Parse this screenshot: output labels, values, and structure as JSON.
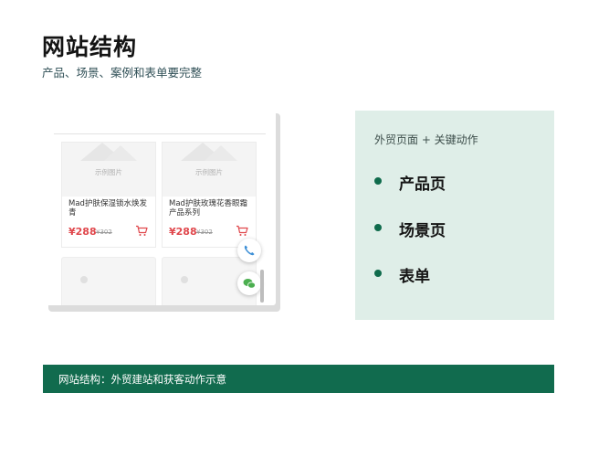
{
  "header": {
    "title": "网站结构",
    "subtitle": "产品、场景、案例和表单要完整"
  },
  "mockup": {
    "products": [
      {
        "image_label": "示例图片",
        "name": "Mad护肤保湿锁水焕发青",
        "price": "¥288",
        "old_price": "¥302"
      },
      {
        "image_label": "示例图片",
        "name": "Mad护肤玫瑰花香眼霜产品系列",
        "price": "¥288",
        "old_price": "¥302"
      }
    ],
    "floating_buttons": [
      "phone-icon",
      "wechat-icon"
    ]
  },
  "panel": {
    "heading": "外贸页面 + 关键动作",
    "items": [
      "产品页",
      "场景页",
      "表单"
    ]
  },
  "banner": {
    "text": "网站结构：外贸建站和获客动作示意"
  },
  "colors": {
    "accent": "#116b4e",
    "panel_bg": "#dfeee8",
    "price": "#e0474c"
  }
}
